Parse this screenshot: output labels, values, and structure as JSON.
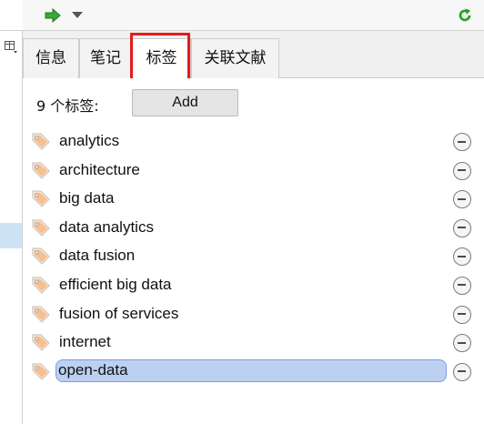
{
  "toolbar": {
    "go_icon": "green-arrow-right-icon",
    "dropdown_icon": "chevron-down-icon",
    "refresh_icon": "green-refresh-icon"
  },
  "tabs": [
    {
      "label": "信息",
      "active": false
    },
    {
      "label": "笔记",
      "active": false
    },
    {
      "label": "标签",
      "active": true
    },
    {
      "label": "关联文献",
      "active": false
    }
  ],
  "tags_panel": {
    "count_label": "9 个标签:",
    "add_label": "Add",
    "tags": [
      {
        "name": "analytics"
      },
      {
        "name": "architecture"
      },
      {
        "name": "big data"
      },
      {
        "name": "data analytics"
      },
      {
        "name": "data fusion"
      },
      {
        "name": "efficient big data"
      },
      {
        "name": "fusion of services"
      },
      {
        "name": "internet"
      },
      {
        "name": "open-data",
        "editing": true
      }
    ]
  },
  "colors": {
    "highlight": "#e8191d",
    "selection": "#bcd0f1",
    "icon_green": "#2e9a2e",
    "tag_icon": "#f2a25c"
  }
}
